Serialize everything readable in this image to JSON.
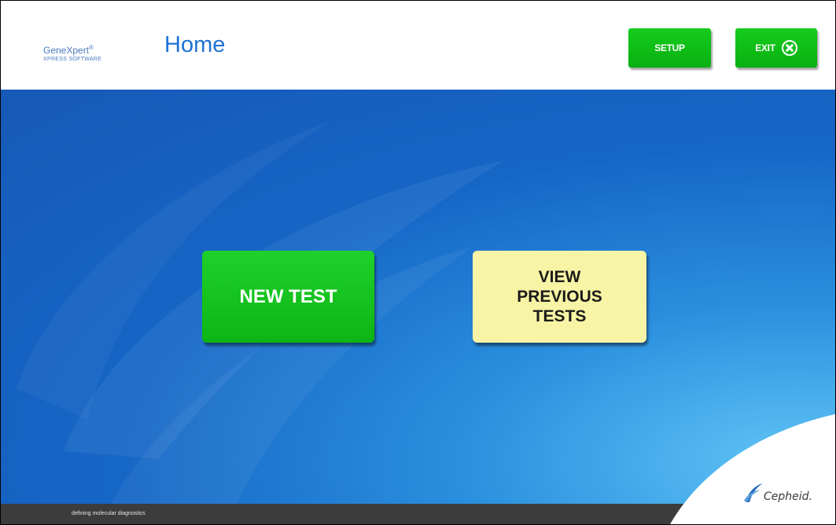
{
  "header": {
    "brand_name": "GeneXpert",
    "brand_mark": "®",
    "brand_sub": "XPRESS SOFTWARE",
    "title": "Home",
    "setup_label": "SETUP",
    "exit_label": "EXIT",
    "exit_icon": "close-circle-icon"
  },
  "main": {
    "new_test_label": "NEW TEST",
    "view_previous_lines": [
      "VIEW",
      "PREVIOUS",
      "TESTS"
    ]
  },
  "footer": {
    "tagline": "defining molecular diagnostics",
    "logo_text": "Cepheid."
  },
  "colors": {
    "accent_green": "#0cb514",
    "title_blue": "#1d72d3",
    "button_yellow": "#f8f4a5",
    "background_blue": "#1666c6",
    "footer_gray": "#3c3c3c"
  }
}
